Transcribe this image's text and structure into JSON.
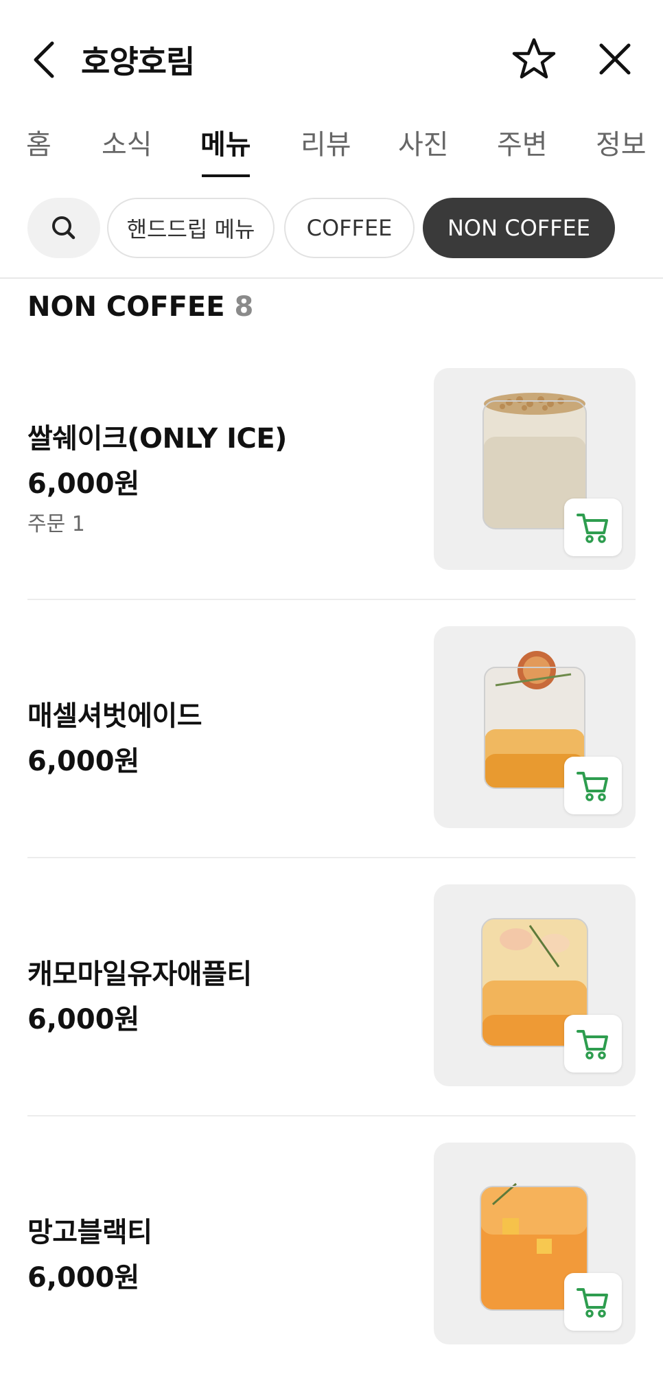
{
  "header": {
    "title": "호양호림"
  },
  "tabs": [
    {
      "label": "홈"
    },
    {
      "label": "소식"
    },
    {
      "label": "메뉴",
      "active": true
    },
    {
      "label": "리뷰"
    },
    {
      "label": "사진"
    },
    {
      "label": "주변"
    },
    {
      "label": "정보"
    }
  ],
  "filters": {
    "chips": [
      {
        "label": "핸드드립 메뉴"
      },
      {
        "label": "COFFEE"
      },
      {
        "label": "NON COFFEE",
        "active": true
      }
    ]
  },
  "section": {
    "title": "NON COFFEE",
    "count": "8"
  },
  "items": [
    {
      "name": "쌀쉐이크(ONLY ICE)",
      "price": "6,000원",
      "orders": "주문 1"
    },
    {
      "name": "매셀셔벗에이드",
      "price": "6,000원"
    },
    {
      "name": "캐모마일유자애플티",
      "price": "6,000원"
    },
    {
      "name": "망고블랙티",
      "price": "6,000원"
    }
  ],
  "colors": {
    "accent_green": "#2e9d4f",
    "active_chip": "#3a3a3a"
  }
}
